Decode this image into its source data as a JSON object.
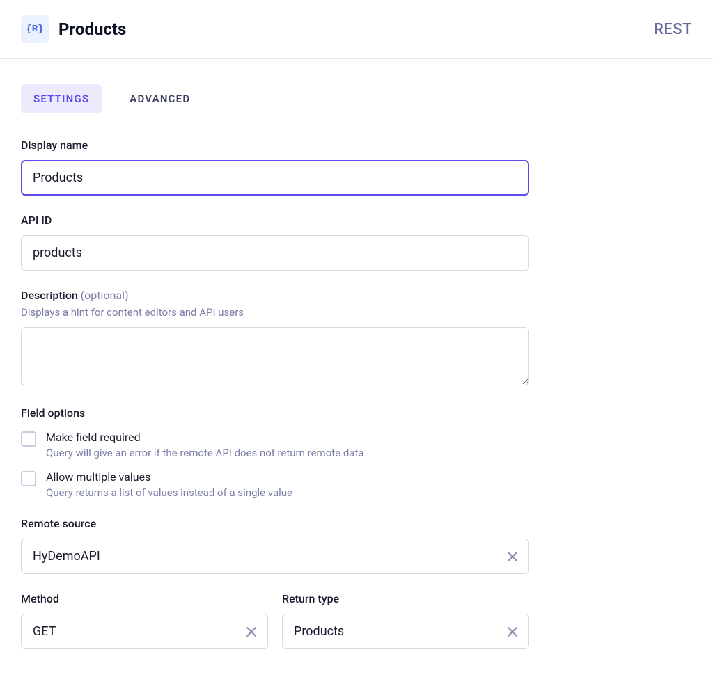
{
  "header": {
    "icon_text": "{R}",
    "title": "Products",
    "badge": "REST"
  },
  "tabs": {
    "settings": "SETTINGS",
    "advanced": "ADVANCED"
  },
  "form": {
    "display_name": {
      "label": "Display name",
      "value": "Products"
    },
    "api_id": {
      "label": "API ID",
      "value": "products"
    },
    "description": {
      "label": "Description",
      "optional": "(optional)",
      "hint": "Displays a hint for content editors and API users",
      "value": ""
    },
    "field_options": {
      "label": "Field options",
      "required": {
        "label": "Make field required",
        "desc": "Query will give an error if the remote API does not return remote data"
      },
      "multiple": {
        "label": "Allow multiple values",
        "desc": "Query returns a list of values instead of a single value"
      }
    },
    "remote_source": {
      "label": "Remote source",
      "value": "HyDemoAPI"
    },
    "method": {
      "label": "Method",
      "value": "GET"
    },
    "return_type": {
      "label": "Return type",
      "value": "Products"
    }
  }
}
